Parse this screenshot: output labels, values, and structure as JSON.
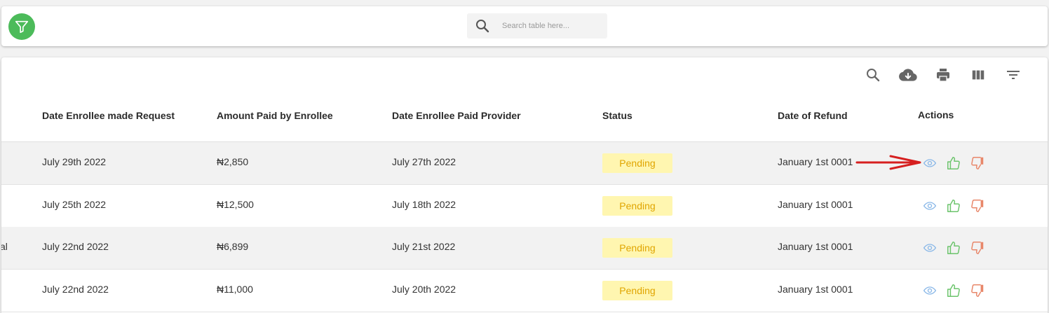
{
  "search": {
    "placeholder": "Search table here..."
  },
  "toolbar": {
    "icons": [
      "search-icon",
      "cloud-download-icon",
      "print-icon",
      "view-columns-icon",
      "filter-list-icon"
    ]
  },
  "table": {
    "columns": [
      "Date Enrollee made Request",
      "Amount Paid by Enrollee",
      "Date Enrollee Paid Provider",
      "Status",
      "Date of Refund",
      "Actions"
    ],
    "rows": [
      {
        "partial": "",
        "request_date": "July 29th 2022",
        "amount": "₦2,850",
        "paid_date": "July 27th 2022",
        "status": "Pending",
        "refund_date": "January 1st 0001"
      },
      {
        "partial": "",
        "request_date": "July 25th 2022",
        "amount": "₦12,500",
        "paid_date": "July 18th 2022",
        "status": "Pending",
        "refund_date": "January 1st 0001"
      },
      {
        "partial": "al",
        "request_date": "July 22nd 2022",
        "amount": "₦6,899",
        "paid_date": "July 21st 2022",
        "status": "Pending",
        "refund_date": "January 1st 0001"
      },
      {
        "partial": "",
        "request_date": "July 22nd 2022",
        "amount": "₦11,000",
        "paid_date": "July 20th 2022",
        "status": "Pending",
        "refund_date": "January 1st 0001"
      }
    ]
  },
  "colors": {
    "fab_green": "#4cbb5a",
    "badge_bg": "#fff6b0",
    "badge_text": "#e0a500",
    "view_blue": "#8ab8e8",
    "approve_green": "#6cc46c",
    "reject_red": "#e8876a",
    "annotation_arrow": "#d61f1f"
  }
}
